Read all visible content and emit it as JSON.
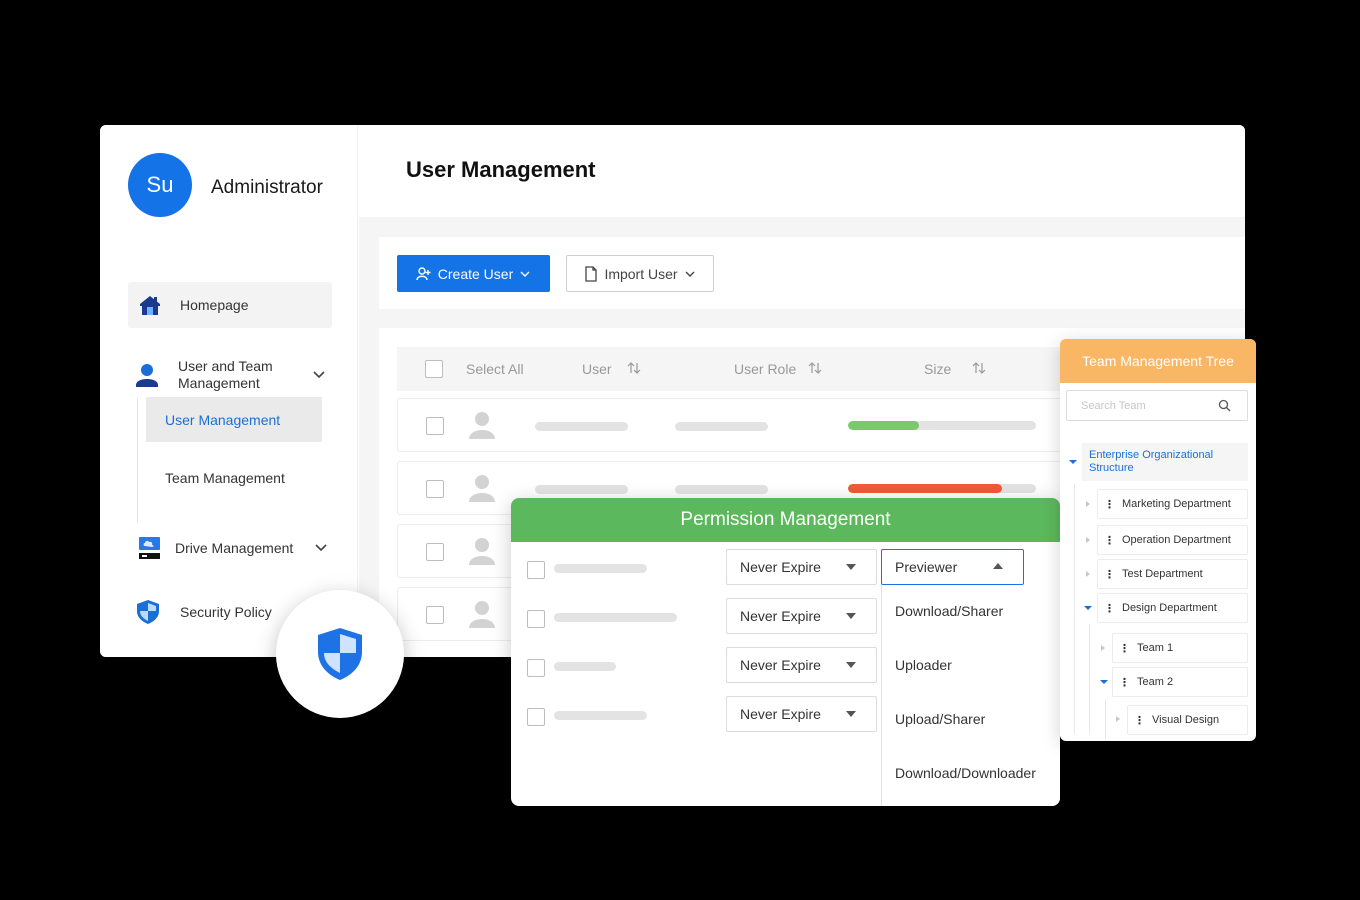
{
  "sidebar": {
    "avatar_initials": "Su",
    "user_name": "Administrator",
    "items": [
      {
        "label": "Homepage",
        "icon": "home-icon"
      },
      {
        "label": "User and Team Management",
        "icon": "user-icon"
      },
      {
        "label": "Drive Management",
        "icon": "drive-icon"
      },
      {
        "label": "Security Policy",
        "icon": "shield-icon"
      }
    ],
    "sub_items": [
      {
        "label": "User Management",
        "active": true
      },
      {
        "label": "Team Management",
        "active": false
      }
    ]
  },
  "main": {
    "title": "User Management",
    "toolbar": {
      "create_label": "Create User",
      "import_label": "Import User"
    },
    "table": {
      "columns": [
        "Select All",
        "User",
        "User Role",
        "Size"
      ],
      "rows": [
        {
          "usage": 0.38,
          "usage_color": "#7dc86f"
        },
        {
          "usage": 0.82,
          "usage_color": "#ee5b38"
        },
        {},
        {}
      ]
    }
  },
  "permission": {
    "title": "Permission Management",
    "expiry_options": [
      "Never Expire",
      "Never Expire",
      "Never Expire",
      "Never Expire"
    ],
    "role_selected": "Previewer",
    "role_options": [
      "Download/Sharer",
      "Uploader",
      "Upload/Sharer",
      "Download/Downloader"
    ]
  },
  "tree": {
    "title": "Team Management Tree",
    "search_placeholder": "Search Team",
    "root": "Enterprise Organizational Structure",
    "nodes": [
      "Marketing Department",
      "Operation Department",
      "Test Department",
      "Design Department",
      "Team 1",
      "Team 2",
      "Visual Design"
    ]
  },
  "colors": {
    "primary": "#1473e6",
    "permission_header": "#5cb85c",
    "tree_header": "#f9b664"
  }
}
